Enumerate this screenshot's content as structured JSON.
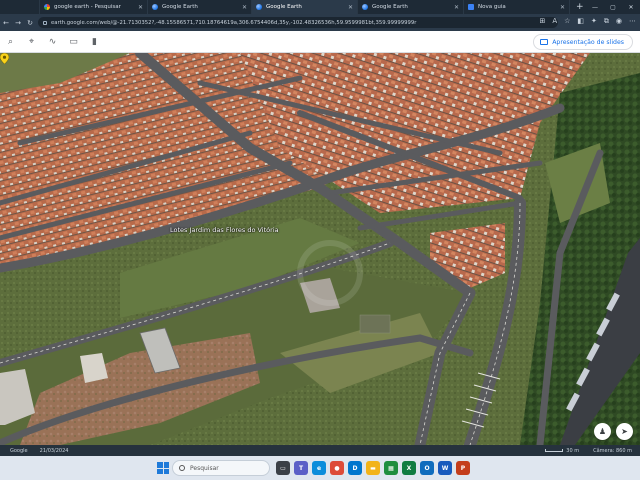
{
  "browser": {
    "tabs": [
      {
        "label": "google earth - Pesquisar",
        "icon": "google-g-icon",
        "active": false
      },
      {
        "label": "Google Earth",
        "icon": "earth-icon",
        "active": false
      },
      {
        "label": "Google Earth",
        "icon": "earth-icon",
        "active": true
      },
      {
        "label": "Google Earth",
        "icon": "earth-icon",
        "active": false
      },
      {
        "label": "Nova guia",
        "icon": "new-tab-icon",
        "active": false
      }
    ],
    "new_tab_label": "+",
    "url": "earth.google.com/web/@-21.7130352?,-48.15586571,710.18764619a,306.6754406d,35y,-102.48326536h,59.9599981bt,359.99999999r"
  },
  "earth_toolbar": {
    "presentation_button": "Apresentação de slides"
  },
  "map": {
    "place_label": "Lotes Jardim das Flores do Vitória"
  },
  "status_bar": {
    "date": "21/03/2024",
    "scale": "30 m",
    "camera": "Câmera: 860 m"
  },
  "taskbar": {
    "search_placeholder": "Pesquisar",
    "apps": [
      {
        "name": "taskview",
        "color": "#3a3f46",
        "glyph": "▭"
      },
      {
        "name": "teams",
        "color": "#5b5fc7",
        "glyph": "T"
      },
      {
        "name": "edge",
        "color": "#0c8ddb",
        "glyph": "e"
      },
      {
        "name": "chrome",
        "color": "#dd4b39",
        "glyph": "●"
      },
      {
        "name": "dell",
        "color": "#0076ce",
        "glyph": "D"
      },
      {
        "name": "explorer",
        "color": "#f2b31a",
        "glyph": "▬"
      },
      {
        "name": "sheets",
        "color": "#1e8e3e",
        "glyph": "▦"
      },
      {
        "name": "excel",
        "color": "#107c41",
        "glyph": "X"
      },
      {
        "name": "outlook",
        "color": "#0f6cbd",
        "glyph": "O"
      },
      {
        "name": "word",
        "color": "#185abd",
        "glyph": "W"
      },
      {
        "name": "powerpoint",
        "color": "#c43e1c",
        "glyph": "P"
      }
    ]
  }
}
